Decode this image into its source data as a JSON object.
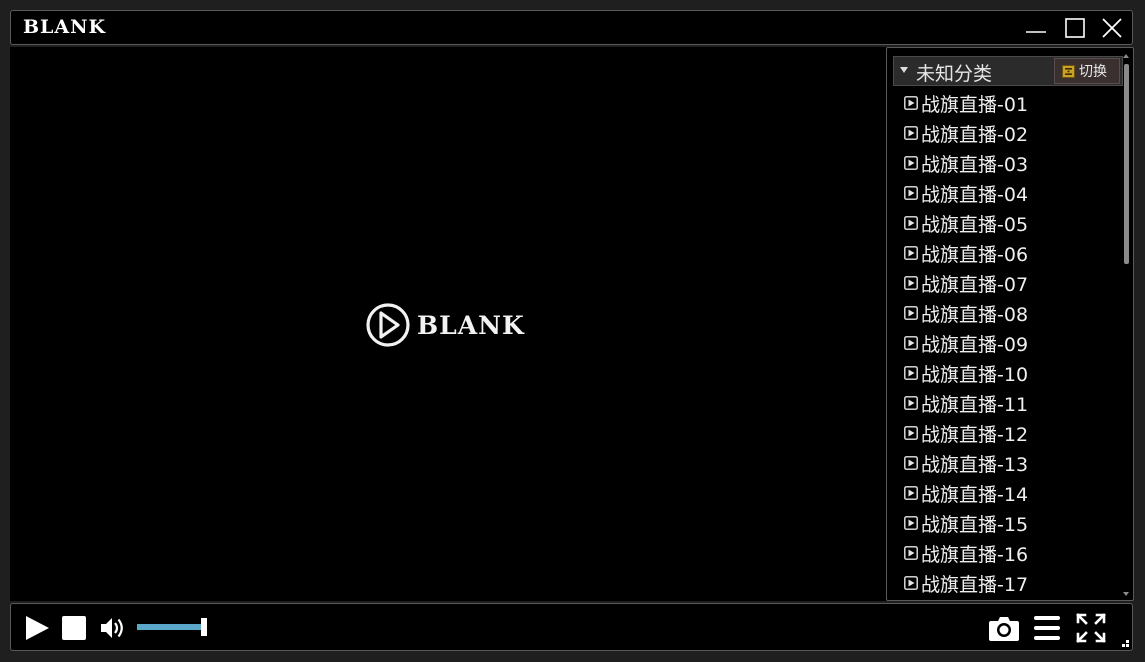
{
  "window": {
    "title": "BLANK",
    "controls": [
      "minimize-icon",
      "maximize-icon",
      "close-icon"
    ]
  },
  "video": {
    "logo_text": "BLANK",
    "logo_icon": "play-circle-icon"
  },
  "playlist": {
    "category": "未知分类",
    "switch_label": "切换",
    "switch_icon": "switch-icon",
    "item_icon": "play-file-icon",
    "items": [
      "战旗直播-01",
      "战旗直播-02",
      "战旗直播-03",
      "战旗直播-04",
      "战旗直播-05",
      "战旗直播-06",
      "战旗直播-07",
      "战旗直播-08",
      "战旗直播-09",
      "战旗直播-10",
      "战旗直播-11",
      "战旗直播-12",
      "战旗直播-13",
      "战旗直播-14",
      "战旗直播-15",
      "战旗直播-16",
      "战旗直播-17"
    ]
  },
  "controls": {
    "play_icon": "play-icon",
    "stop_icon": "stop-icon",
    "volume_icon": "volume-icon",
    "volume_level": 0.95,
    "screenshot_icon": "camera-icon",
    "playlist_icon": "menu-icon",
    "fullscreen_icon": "fullscreen-icon"
  },
  "colors": {
    "accent": "#5aa7c9",
    "background": "#000000",
    "frame": "#1f1f1f",
    "border": "#5a5a5a"
  }
}
